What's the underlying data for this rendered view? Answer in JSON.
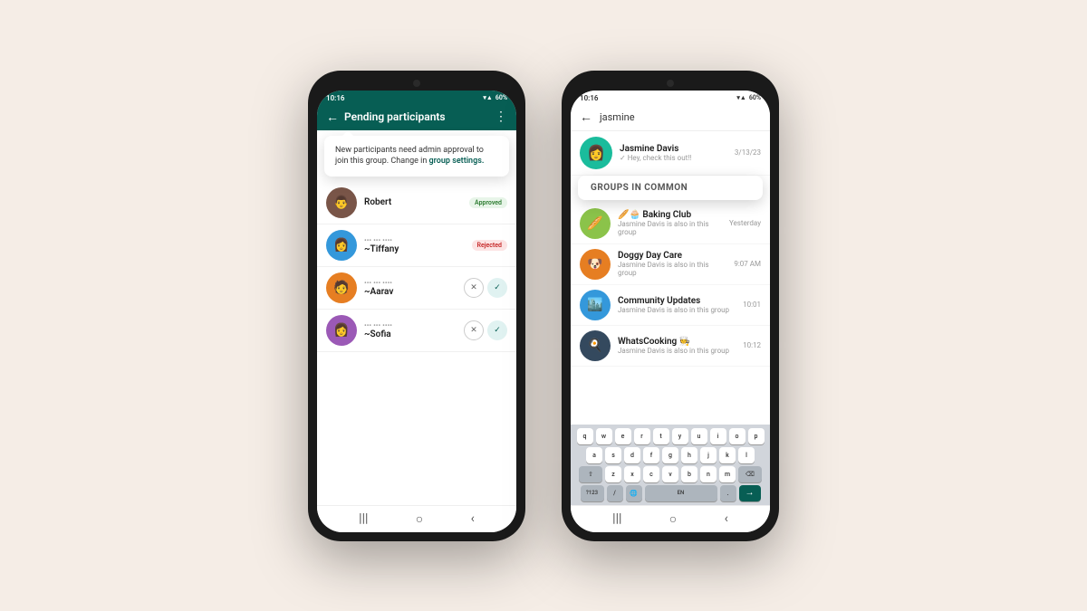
{
  "page": {
    "background": "#f5ede6"
  },
  "phone1": {
    "status_time": "10:16",
    "status_icons": "▼▲ 60%",
    "header_title": "Pending participants",
    "back_icon": "←",
    "more_icon": "⋮",
    "tooltip_text": "New participants need admin approval to join this group. Change in ",
    "tooltip_link": "group settings.",
    "participants": [
      {
        "name": "Robert",
        "sub": "",
        "status": "Approved",
        "avatar_emoji": "👨",
        "avatar_color": "av-brown"
      },
      {
        "name": "~Tiffany",
        "sub": "••• ••• •••",
        "status": "Rejected",
        "avatar_emoji": "👩",
        "avatar_color": "av-blue"
      },
      {
        "name": "~Aarav",
        "sub": "••• ••• •••",
        "status": "pending",
        "avatar_emoji": "🧑",
        "avatar_color": "av-orange"
      },
      {
        "name": "~Sofia",
        "sub": "••• ••• •••",
        "status": "pending",
        "avatar_emoji": "👩",
        "avatar_color": "av-purple"
      }
    ],
    "nav": {
      "menu_icon": "|||",
      "home_icon": "○",
      "back_icon": "<"
    }
  },
  "phone2": {
    "status_time": "10:16",
    "status_icons": "▼▲ 60%",
    "back_icon": "←",
    "search_value": "jasmine",
    "contact": {
      "name": "Jasmine Davis",
      "sub": "✓ Hey, check this out!!",
      "time": "3/13/23",
      "avatar_emoji": "👩",
      "avatar_color": "av-teal"
    },
    "groups_common_label": "GROUPS IN COMMON",
    "groups": [
      {
        "name": "🥖🧁 Baking Club",
        "sub": "Jasmine Davis is also in this group",
        "time": "Yesterday",
        "avatar_emoji": "🥖",
        "avatar_color": "av-baking"
      },
      {
        "name": "Doggy Day Care",
        "sub": "Jasmine Davis is also in this group",
        "time": "9:07 AM",
        "avatar_emoji": "🐶",
        "avatar_color": "av-orange"
      },
      {
        "name": "Community Updates",
        "sub": "Jasmine Davis is also in this group",
        "time": "10:01",
        "avatar_emoji": "🏙️",
        "avatar_color": "av-blue"
      },
      {
        "name": "WhatsCooking 🧑‍🍳",
        "sub": "Jasmine Davis is also in this group",
        "time": "10:12",
        "avatar_emoji": "🍳",
        "avatar_color": "av-dark"
      }
    ],
    "keyboard": {
      "rows": [
        [
          "q",
          "w",
          "e",
          "r",
          "t",
          "y",
          "u",
          "i",
          "o",
          "p"
        ],
        [
          "a",
          "s",
          "d",
          "f",
          "g",
          "h",
          "j",
          "k",
          "l"
        ],
        [
          "⇧",
          "z",
          "x",
          "c",
          "v",
          "b",
          "n",
          "m",
          "⌫"
        ],
        [
          "?123",
          "/",
          "🌐",
          "EN",
          ".",
          "→"
        ]
      ]
    },
    "nav": {
      "menu_icon": "|||",
      "home_icon": "○",
      "back_icon": "<"
    }
  }
}
